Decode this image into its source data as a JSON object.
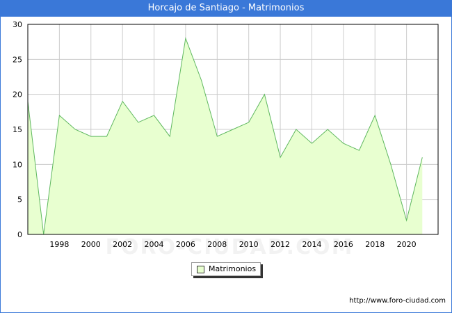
{
  "title": "Horcajo de Santiago - Matrimonios",
  "footer_url": "http://www.foro-ciudad.com",
  "watermark": "FORO-CIUDAD.COM",
  "colors": {
    "title_bar": "#3a78d8",
    "area_fill": "#e8ffd0",
    "line": "#5fb85f",
    "grid": "#cccccc"
  },
  "chart_data": {
    "type": "area",
    "title": "Horcajo de Santiago - Matrimonios",
    "x": [
      1996,
      1997,
      1998,
      1999,
      2000,
      2001,
      2002,
      2003,
      2004,
      2005,
      2006,
      2007,
      2008,
      2009,
      2010,
      2011,
      2012,
      2013,
      2014,
      2015,
      2016,
      2017,
      2018,
      2019,
      2020,
      2021
    ],
    "series": [
      {
        "name": "Matrimonios",
        "values": [
          19,
          0,
          17,
          15,
          14,
          14,
          19,
          16,
          17,
          14,
          28,
          22,
          14,
          15,
          16,
          20,
          11,
          15,
          13,
          15,
          13,
          12,
          17,
          10,
          2,
          11
        ]
      }
    ],
    "xlim": [
      1996,
      2022
    ],
    "ylim": [
      0,
      30
    ],
    "x_ticks": [
      1998,
      2000,
      2002,
      2004,
      2006,
      2008,
      2010,
      2012,
      2014,
      2016,
      2018,
      2020
    ],
    "y_ticks": [
      0,
      5,
      10,
      15,
      20,
      25,
      30
    ],
    "grid": true,
    "legend": "bottom-center"
  }
}
